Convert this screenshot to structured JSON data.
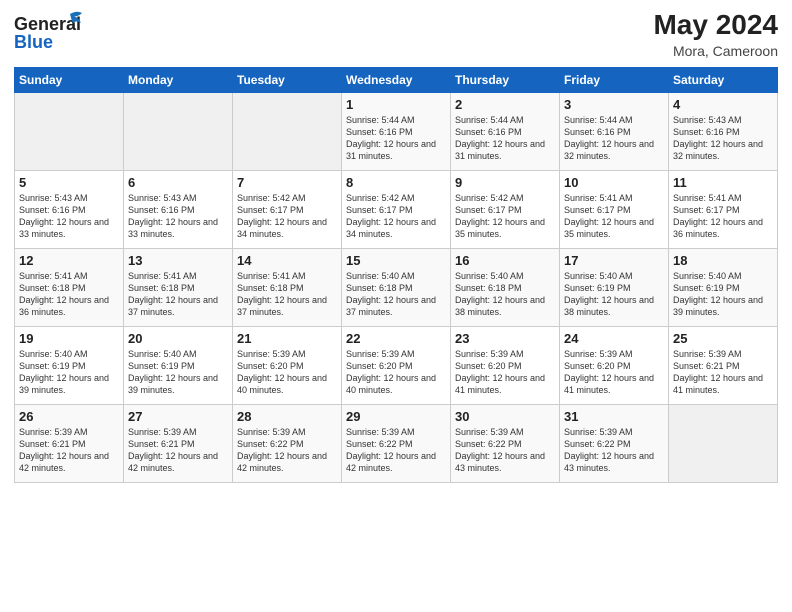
{
  "header": {
    "logo_general": "General",
    "logo_blue": "Blue",
    "title": "May 2024",
    "subtitle": "Mora, Cameroon"
  },
  "days_of_week": [
    "Sunday",
    "Monday",
    "Tuesday",
    "Wednesday",
    "Thursday",
    "Friday",
    "Saturday"
  ],
  "weeks": [
    [
      {
        "day": "",
        "info": ""
      },
      {
        "day": "",
        "info": ""
      },
      {
        "day": "",
        "info": ""
      },
      {
        "day": "1",
        "info": "Sunrise: 5:44 AM\nSunset: 6:16 PM\nDaylight: 12 hours and 31 minutes."
      },
      {
        "day": "2",
        "info": "Sunrise: 5:44 AM\nSunset: 6:16 PM\nDaylight: 12 hours and 31 minutes."
      },
      {
        "day": "3",
        "info": "Sunrise: 5:44 AM\nSunset: 6:16 PM\nDaylight: 12 hours and 32 minutes."
      },
      {
        "day": "4",
        "info": "Sunrise: 5:43 AM\nSunset: 6:16 PM\nDaylight: 12 hours and 32 minutes."
      }
    ],
    [
      {
        "day": "5",
        "info": "Sunrise: 5:43 AM\nSunset: 6:16 PM\nDaylight: 12 hours and 33 minutes."
      },
      {
        "day": "6",
        "info": "Sunrise: 5:43 AM\nSunset: 6:16 PM\nDaylight: 12 hours and 33 minutes."
      },
      {
        "day": "7",
        "info": "Sunrise: 5:42 AM\nSunset: 6:17 PM\nDaylight: 12 hours and 34 minutes."
      },
      {
        "day": "8",
        "info": "Sunrise: 5:42 AM\nSunset: 6:17 PM\nDaylight: 12 hours and 34 minutes."
      },
      {
        "day": "9",
        "info": "Sunrise: 5:42 AM\nSunset: 6:17 PM\nDaylight: 12 hours and 35 minutes."
      },
      {
        "day": "10",
        "info": "Sunrise: 5:41 AM\nSunset: 6:17 PM\nDaylight: 12 hours and 35 minutes."
      },
      {
        "day": "11",
        "info": "Sunrise: 5:41 AM\nSunset: 6:17 PM\nDaylight: 12 hours and 36 minutes."
      }
    ],
    [
      {
        "day": "12",
        "info": "Sunrise: 5:41 AM\nSunset: 6:18 PM\nDaylight: 12 hours and 36 minutes."
      },
      {
        "day": "13",
        "info": "Sunrise: 5:41 AM\nSunset: 6:18 PM\nDaylight: 12 hours and 37 minutes."
      },
      {
        "day": "14",
        "info": "Sunrise: 5:41 AM\nSunset: 6:18 PM\nDaylight: 12 hours and 37 minutes."
      },
      {
        "day": "15",
        "info": "Sunrise: 5:40 AM\nSunset: 6:18 PM\nDaylight: 12 hours and 37 minutes."
      },
      {
        "day": "16",
        "info": "Sunrise: 5:40 AM\nSunset: 6:18 PM\nDaylight: 12 hours and 38 minutes."
      },
      {
        "day": "17",
        "info": "Sunrise: 5:40 AM\nSunset: 6:19 PM\nDaylight: 12 hours and 38 minutes."
      },
      {
        "day": "18",
        "info": "Sunrise: 5:40 AM\nSunset: 6:19 PM\nDaylight: 12 hours and 39 minutes."
      }
    ],
    [
      {
        "day": "19",
        "info": "Sunrise: 5:40 AM\nSunset: 6:19 PM\nDaylight: 12 hours and 39 minutes."
      },
      {
        "day": "20",
        "info": "Sunrise: 5:40 AM\nSunset: 6:19 PM\nDaylight: 12 hours and 39 minutes."
      },
      {
        "day": "21",
        "info": "Sunrise: 5:39 AM\nSunset: 6:20 PM\nDaylight: 12 hours and 40 minutes."
      },
      {
        "day": "22",
        "info": "Sunrise: 5:39 AM\nSunset: 6:20 PM\nDaylight: 12 hours and 40 minutes."
      },
      {
        "day": "23",
        "info": "Sunrise: 5:39 AM\nSunset: 6:20 PM\nDaylight: 12 hours and 41 minutes."
      },
      {
        "day": "24",
        "info": "Sunrise: 5:39 AM\nSunset: 6:20 PM\nDaylight: 12 hours and 41 minutes."
      },
      {
        "day": "25",
        "info": "Sunrise: 5:39 AM\nSunset: 6:21 PM\nDaylight: 12 hours and 41 minutes."
      }
    ],
    [
      {
        "day": "26",
        "info": "Sunrise: 5:39 AM\nSunset: 6:21 PM\nDaylight: 12 hours and 42 minutes."
      },
      {
        "day": "27",
        "info": "Sunrise: 5:39 AM\nSunset: 6:21 PM\nDaylight: 12 hours and 42 minutes."
      },
      {
        "day": "28",
        "info": "Sunrise: 5:39 AM\nSunset: 6:22 PM\nDaylight: 12 hours and 42 minutes."
      },
      {
        "day": "29",
        "info": "Sunrise: 5:39 AM\nSunset: 6:22 PM\nDaylight: 12 hours and 42 minutes."
      },
      {
        "day": "30",
        "info": "Sunrise: 5:39 AM\nSunset: 6:22 PM\nDaylight: 12 hours and 43 minutes."
      },
      {
        "day": "31",
        "info": "Sunrise: 5:39 AM\nSunset: 6:22 PM\nDaylight: 12 hours and 43 minutes."
      },
      {
        "day": "",
        "info": ""
      }
    ]
  ]
}
